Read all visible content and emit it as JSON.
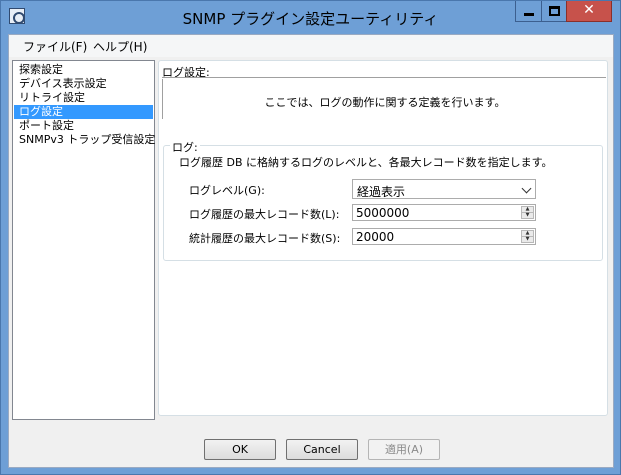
{
  "window": {
    "title": "SNMP プラグイン設定ユーティリティ",
    "close_symbol": "✕"
  },
  "menu": {
    "file": "ファイル(F)",
    "help": "ヘルプ(H)"
  },
  "nav": {
    "items": [
      {
        "label": "探索設定"
      },
      {
        "label": "デバイス表示設定"
      },
      {
        "label": "リトライ設定"
      },
      {
        "label": "ログ設定",
        "selected": true
      },
      {
        "label": "ポート設定"
      },
      {
        "label": "SNMPv3 トラップ受信設定"
      }
    ]
  },
  "content": {
    "section_title": "ログ設定:",
    "description": "ここでは、ログの動作に関する定義を行います。",
    "group": {
      "label": "ログ:",
      "description": "ログ履歴 DB に格納するログのレベルと、各最大レコード数を指定します。",
      "log_level_label": "ログレベル(G):",
      "log_level_value": "経過表示",
      "max_history_label": "ログ履歴の最大レコード数(L):",
      "max_history_value": "5000000",
      "max_stats_label": "統計履歴の最大レコード数(S):",
      "max_stats_value": "20000"
    }
  },
  "buttons": {
    "ok": "OK",
    "cancel": "Cancel",
    "apply": "適用(A)"
  },
  "colors": {
    "titlebar": "#6e9fd6",
    "close": "#c7524b",
    "selection": "#3399ff"
  }
}
